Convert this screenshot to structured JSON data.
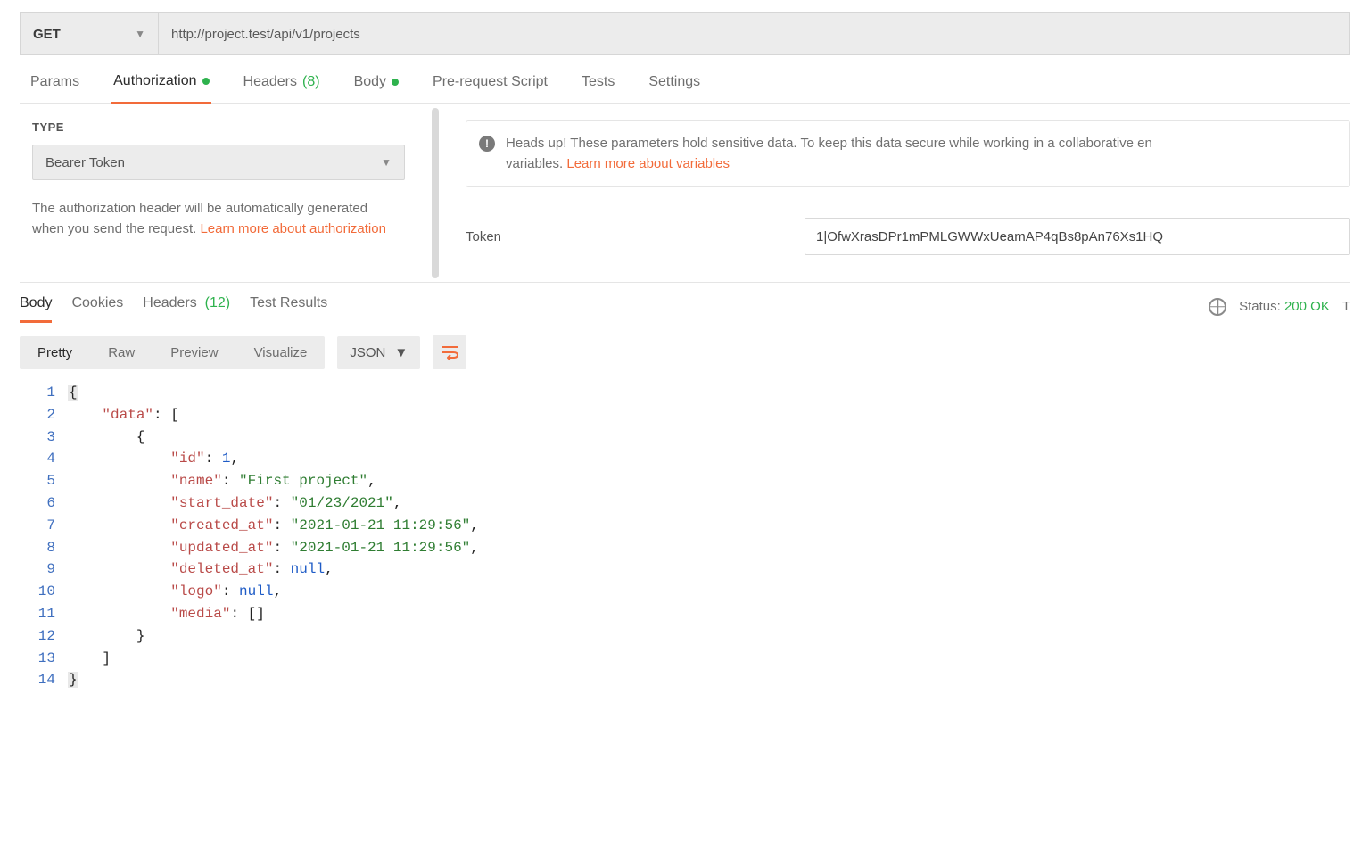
{
  "request": {
    "method": "GET",
    "url": "http://project.test/api/v1/projects"
  },
  "req_tabs": {
    "params": "Params",
    "authorization": "Authorization",
    "headers": "Headers",
    "headers_count": "(8)",
    "body": "Body",
    "prerequest": "Pre-request Script",
    "tests": "Tests",
    "settings": "Settings"
  },
  "auth": {
    "type_heading": "TYPE",
    "type_value": "Bearer Token",
    "desc_a": "The authorization header will be automatically generated when you send the request. ",
    "desc_link": "Learn more about authorization",
    "alert_text": "Heads up! These parameters hold sensitive data. To keep this data secure while working in a collaborative en",
    "alert_text2": "variables. ",
    "alert_link": "Learn more about variables",
    "token_label": "Token",
    "token_value": "1|OfwXrasDPr1mPMLGWWxUeamAP4qBs8pAn76Xs1HQ"
  },
  "resp_tabs": {
    "body": "Body",
    "cookies": "Cookies",
    "headers": "Headers",
    "headers_count": "(12)",
    "test_results": "Test Results"
  },
  "resp_status": {
    "label": "Status:",
    "value": "200 OK",
    "trailing": "T"
  },
  "body_toolbar": {
    "pretty": "Pretty",
    "raw": "Raw",
    "preview": "Preview",
    "visualize": "Visualize",
    "lang": "JSON"
  },
  "response_json": {
    "data": [
      {
        "id": 1,
        "name": "First project",
        "start_date": "01/23/2021",
        "created_at": "2021-01-21 11:29:56",
        "updated_at": "2021-01-21 11:29:56",
        "deleted_at": null,
        "logo": null,
        "media": []
      }
    ]
  },
  "line_count": 14
}
